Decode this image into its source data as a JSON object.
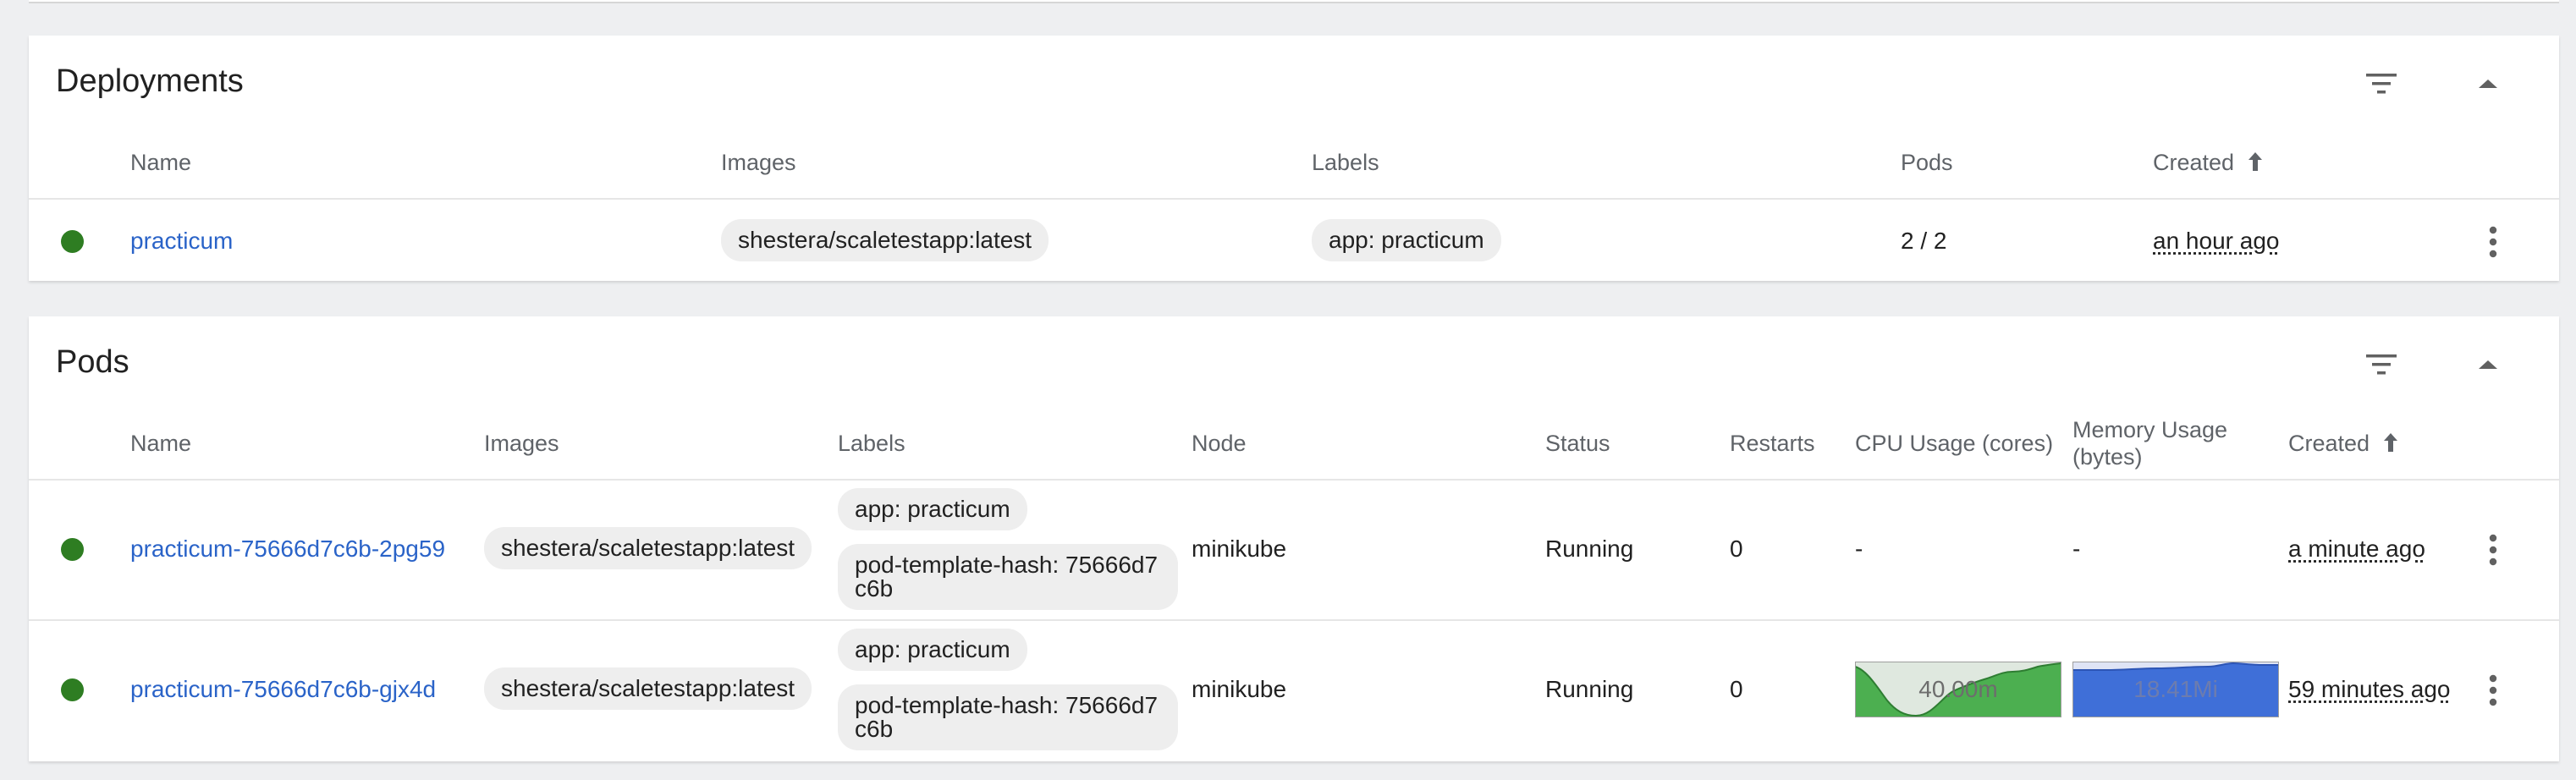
{
  "deployments": {
    "title": "Deployments",
    "columns": {
      "name": "Name",
      "images": "Images",
      "labels": "Labels",
      "pods": "Pods",
      "created": "Created"
    },
    "rows": [
      {
        "name": "practicum",
        "image": "shestera/scaletestapp:latest",
        "label": "app: practicum",
        "pods": "2 / 2",
        "created": "an hour ago"
      }
    ]
  },
  "pods": {
    "title": "Pods",
    "columns": {
      "name": "Name",
      "images": "Images",
      "labels": "Labels",
      "node": "Node",
      "status": "Status",
      "restarts": "Restarts",
      "cpu": "CPU Usage (cores)",
      "memory_line1": "Memory Usage",
      "memory_line2": "(bytes)",
      "created": "Created"
    },
    "rows": [
      {
        "name": "practicum-75666d7c6b-2pg59",
        "image": "shestera/scaletestapp:latest",
        "label_app": "app: practicum",
        "label_hash": "pod-template-hash: 75666d7c6b",
        "node": "minikube",
        "status": "Running",
        "restarts": "0",
        "cpu": "-",
        "memory": "-",
        "created": "a minute ago"
      },
      {
        "name": "practicum-75666d7c6b-gjx4d",
        "image": "shestera/scaletestapp:latest",
        "label_app": "app: practicum",
        "label_hash": "pod-template-hash: 75666d7c6b",
        "node": "minikube",
        "status": "Running",
        "restarts": "0",
        "cpu": "40.00m",
        "memory": "18.41Mi",
        "created": "59 minutes ago"
      }
    ]
  },
  "icons": {
    "filter": "filter-icon",
    "collapse": "arrow-up-icon",
    "sort": "sort-ascending-icon",
    "more": "more-vertical-icon",
    "status": "status-running-dot"
  },
  "colors": {
    "running": "#2e7d22",
    "link": "#2a63c8",
    "cpu_spark": "#4caf50",
    "memory_spark": "#3f6fd8"
  }
}
